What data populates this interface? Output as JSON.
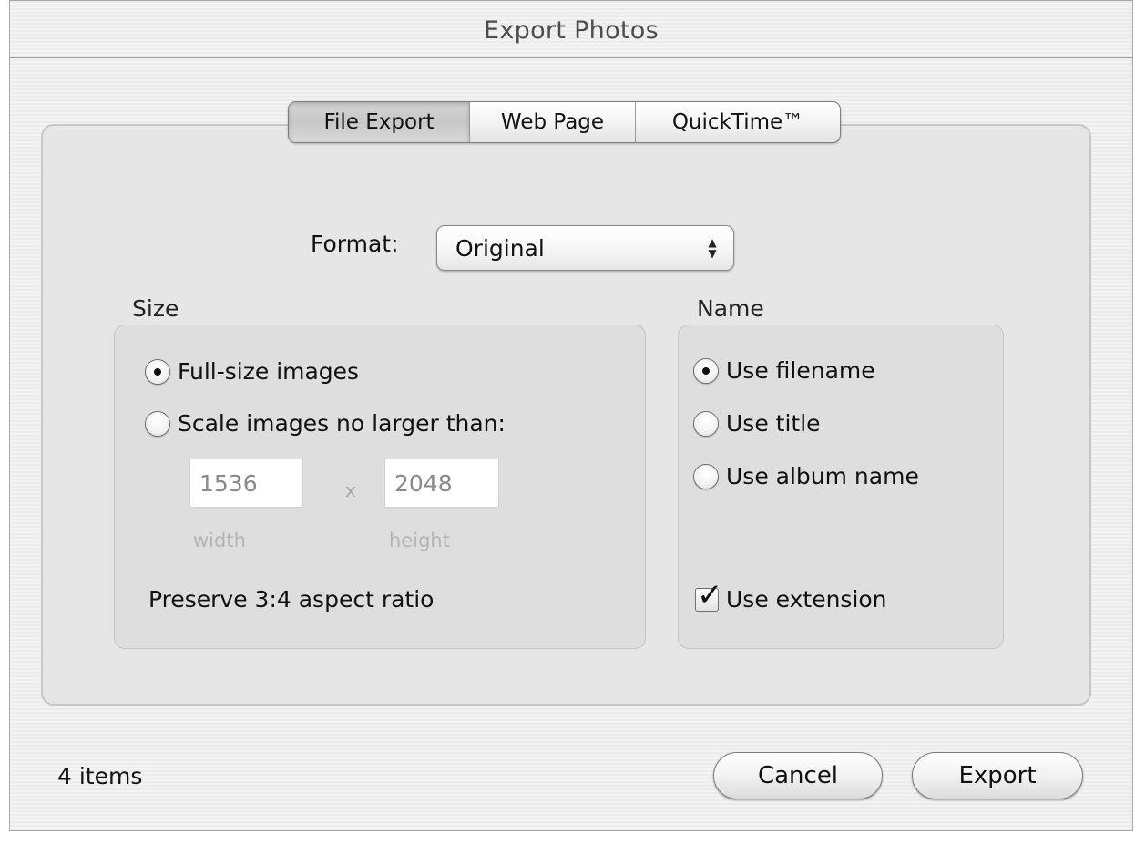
{
  "window": {
    "title": "Export Photos"
  },
  "tabs": [
    {
      "label": "File Export",
      "selected": true
    },
    {
      "label": "Web Page",
      "selected": false
    },
    {
      "label": "QuickTime™",
      "selected": false
    }
  ],
  "format": {
    "label": "Format:",
    "value": "Original"
  },
  "size": {
    "label": "Size",
    "options": [
      {
        "label": "Full-size images",
        "selected": true
      },
      {
        "label": "Scale images no larger than:",
        "selected": false
      }
    ],
    "width_value": "1536",
    "height_value": "2048",
    "separator": "x",
    "width_label": "width",
    "height_label": "height",
    "aspect_text": "Preserve 3:4 aspect ratio"
  },
  "name": {
    "label": "Name",
    "options": [
      {
        "label": "Use filename",
        "selected": true
      },
      {
        "label": "Use title",
        "selected": false
      },
      {
        "label": "Use album name",
        "selected": false
      }
    ],
    "extension": {
      "label": "Use extension",
      "checked": true
    }
  },
  "footer": {
    "items_count": "4 items",
    "cancel_label": "Cancel",
    "export_label": "Export"
  }
}
